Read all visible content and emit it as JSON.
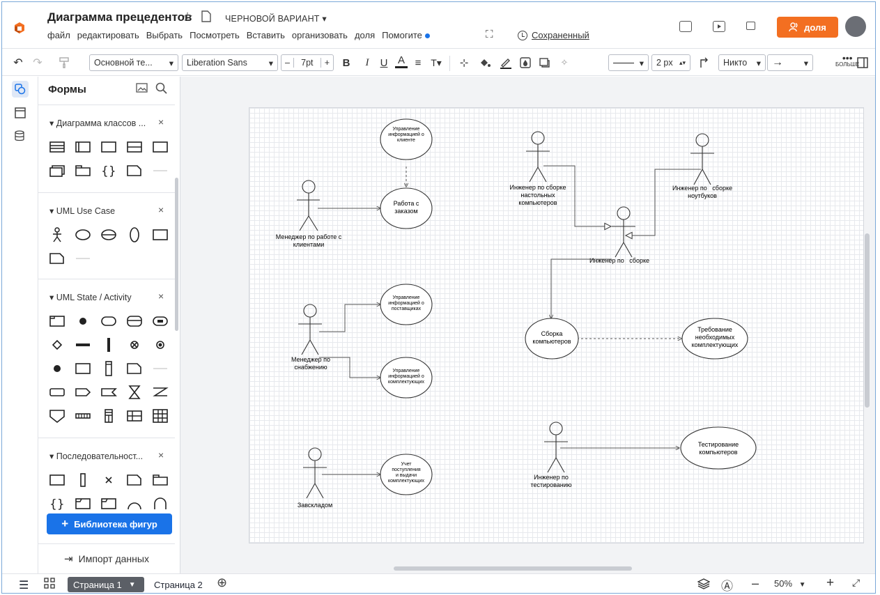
{
  "header": {
    "title": "Диаграмма прецедентов",
    "draft_label": "ЧЕРНОВОЙ ВАРИАНТ ▾",
    "saved_label": "Сохраненный",
    "share_label": "доля",
    "accent_color": "#f36f21"
  },
  "menu": {
    "items": [
      "файл",
      "редактировать",
      "Выбрать",
      "Посмотреть",
      "Вставить",
      "организовать",
      "доля",
      "Помогите"
    ]
  },
  "toolbar": {
    "style_select": "Основной те...",
    "font_select": "Liberation Sans",
    "font_size": "7pt",
    "line_width": "2 px",
    "arrow_start": "Никто",
    "more_label": "БОЛЬШЕ"
  },
  "panel": {
    "title": "Формы",
    "groups": [
      {
        "title": "Диаграмма классов ..."
      },
      {
        "title": "UML Use Case"
      },
      {
        "title": "UML State / Activity"
      },
      {
        "title": "Последовательност..."
      }
    ],
    "library_button": "Библиотека фигур",
    "import_label": "Импорт данных"
  },
  "diagram": {
    "actors": {
      "manager_clients": [
        "Менеджер по работе с",
        "клиентами"
      ],
      "desktop_engineer": [
        "Инженер по сборке",
        "настольных",
        "компьютеров"
      ],
      "laptop_engineer": [
        "Инженер по   сборке",
        "ноутбуков"
      ],
      "assembly_engineer": [
        "Инженер по   сборке"
      ],
      "supply_manager": [
        "Менеджер по",
        "снабжению"
      ],
      "warehouse": [
        "Завскладом"
      ],
      "test_engineer": [
        "Инженер по",
        "тестированию"
      ]
    },
    "usecases": {
      "client_info": [
        "Управление",
        "информацией о",
        "клиенте"
      ],
      "order": [
        "Работа с",
        "заказом"
      ],
      "supplier_info": [
        "Управление",
        "информацией о",
        "поставщиках"
      ],
      "component_info": [
        "Управление",
        "информацией о",
        "комплектующих"
      ],
      "assembly": [
        "Сборка",
        "компьютеров"
      ],
      "requirement": [
        "Требование",
        "необходимых",
        "комплектующих"
      ],
      "accounting": [
        "Учет",
        "поступления",
        "и выдачи",
        "комплектующих"
      ],
      "testing": [
        "Тестирование",
        "компьютеров"
      ]
    }
  },
  "footer": {
    "page_tabs": [
      "Страница 1",
      "Страница 2"
    ],
    "zoom": "50%"
  }
}
